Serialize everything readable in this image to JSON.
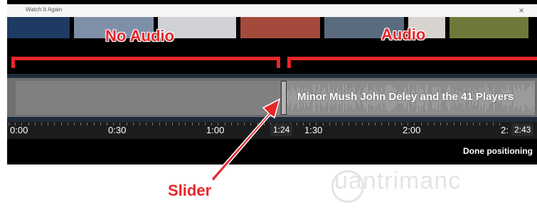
{
  "window": {
    "title": "Watch It Again",
    "close_glyph": "×"
  },
  "thumbnails": [
    {
      "name": "thumb-1",
      "color": "#1d3b63"
    },
    {
      "name": "thumb-2",
      "color": "#7e8fa8"
    },
    {
      "name": "thumb-3",
      "color": "#d0d2d6"
    },
    {
      "name": "thumb-4",
      "color": "#a44a3c"
    },
    {
      "name": "thumb-5",
      "color": "#5a6b7e"
    },
    {
      "name": "thumb-6",
      "color": "#d7d3cf"
    },
    {
      "name": "thumb-7",
      "color": "#6e7a3c"
    }
  ],
  "annotations": {
    "no_audio": "No Audio",
    "audio": "Audio",
    "slider": "Slider"
  },
  "track": {
    "song": "Minor Mush John Deley and the 41 Players"
  },
  "timeline": {
    "labels": [
      "0:00",
      "0:30",
      "1:00",
      "1:30",
      "2:00",
      "2:"
    ],
    "current": "1:24",
    "end": "2:43"
  },
  "footer": {
    "done_label": "Done positioning"
  },
  "watermark": {
    "text": "uantrimanc"
  },
  "colors": {
    "accent": "#e8262a",
    "track_bg": "#6f6f6f"
  }
}
